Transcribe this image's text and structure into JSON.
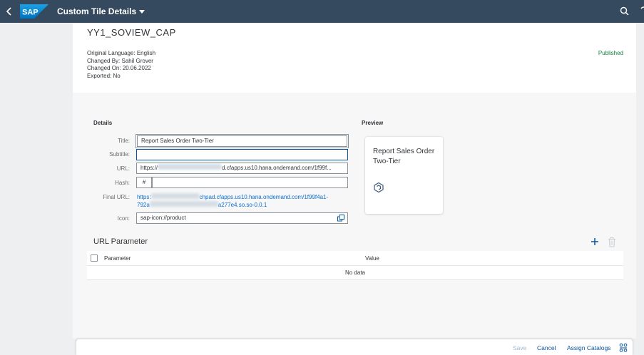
{
  "shell": {
    "logo_text": "SAP",
    "title": "Custom Tile Details",
    "icons": {
      "back": "back-chevron-icon",
      "search": "search-icon",
      "more": "overflow-icon"
    }
  },
  "header": {
    "object_title": "YY1_SOVIEW_CAP",
    "original_language": "Original Language: English",
    "changed_by": "Changed By: Sahil Grover",
    "changed_on": "Changed On: 20.06.2022",
    "exported": "Exported: No",
    "status": "Published",
    "status_color": "#107e3e"
  },
  "details": {
    "section_title": "Details",
    "title_label": "Title:",
    "title_value": "Report Sales Order Two-Tier",
    "subtitle_label": "Subtitle:",
    "subtitle_value": "",
    "url_label": "URL:",
    "url_prefix": "https://",
    "url_suffix": "d.cfapps.us10.hana.ondemand.com/1f99f...",
    "hash_label": "Hash:",
    "hash_symbol": "#",
    "hash_value": "",
    "final_url_label": "Final URL:",
    "final_url_line1_prefix": "https:",
    "final_url_line1_suffix": "chpad.cfapps.us10.hana.ondemand.com/1f99f4a1-",
    "final_url_line2_prefix": "792a",
    "final_url_line2_suffix": "a277e4.so.so-0.0.1",
    "icon_label": "Icon:",
    "icon_value": "sap-icon://product"
  },
  "preview": {
    "section_title": "Preview",
    "tile_title": "Report Sales Order Two-Tier",
    "tile_icon": "product-cube-icon"
  },
  "url_parameter": {
    "title": "URL Parameter",
    "columns": [
      "Parameter",
      "Value"
    ],
    "empty_text": "No data"
  },
  "footer": {
    "save": "Save",
    "cancel": "Cancel",
    "assign_catalogs": "Assign Catalogs"
  },
  "colors": {
    "shell": "#354a5f",
    "link": "#0a6ed1",
    "button_text": "#0854a0"
  }
}
